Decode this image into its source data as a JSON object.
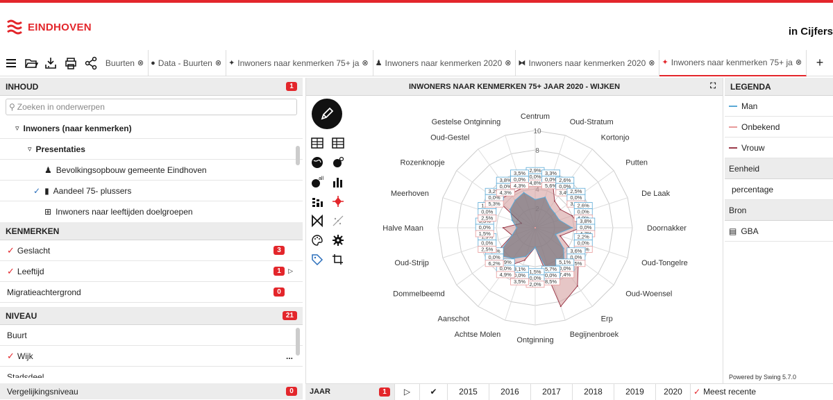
{
  "header": {
    "brand": "EINDHOVEN",
    "title": "in Cijfers"
  },
  "toolbar": {
    "tabs": [
      {
        "label": "Buurten",
        "icon": "none"
      },
      {
        "label": "Data - Buurten",
        "icon": "globe-icon"
      },
      {
        "label": "Inwoners naar kenmerken 75+ ja",
        "icon": "crosshair-icon"
      },
      {
        "label": "Inwoners naar kenmerken 2020",
        "icon": "population-icon"
      },
      {
        "label": "Inwoners naar kenmerken 2020",
        "icon": "butterfly-icon"
      },
      {
        "label": "Inwoners naar kenmerken 75+ ja",
        "icon": "crosshair-icon"
      }
    ],
    "add_label": "+"
  },
  "inhoud": {
    "title": "INHOUD",
    "count": "1",
    "search_placeholder": "Zoeken in onderwerpen",
    "items": [
      {
        "label": "Inwoners (naar kenmerken)",
        "prefix": "▿"
      },
      {
        "label": "Presentaties",
        "prefix": "▿"
      },
      {
        "label": "Bevolkingsopbouw gemeente Eindhoven",
        "prefix": ""
      },
      {
        "label": "Aandeel 75- plussers",
        "prefix": "✓"
      },
      {
        "label": "Inwoners naar leeftijden doelgroepen",
        "prefix": ""
      }
    ]
  },
  "kenmerken": {
    "title": "KENMERKEN",
    "items": [
      {
        "label": "Geslacht",
        "count": "3",
        "checked": true
      },
      {
        "label": "Leeftijd",
        "count": "1",
        "checked": true
      },
      {
        "label": "Migratieachtergrond",
        "count": "0",
        "checked": false
      }
    ]
  },
  "niveau": {
    "title": "NIVEAU",
    "count": "21",
    "items": [
      {
        "label": "Buurt",
        "checked": false
      },
      {
        "label": "Wijk",
        "checked": true,
        "more": "..."
      },
      {
        "label": "Stadsdeel",
        "checked": false
      }
    ]
  },
  "vergelijk": {
    "label": "Vergelijkingsniveau",
    "count": "0"
  },
  "chart_panel": {
    "title": "INWONERS NAAR KENMERKEN 75+ JAAR 2020 - WIJKEN"
  },
  "legenda": {
    "title": "LEGENDA",
    "series": [
      {
        "label": "Man",
        "color": "#5aa9d6"
      },
      {
        "label": "Onbekend",
        "color": "#e89a9a"
      },
      {
        "label": "Vrouw",
        "color": "#9b3a4a"
      }
    ],
    "eenheid_label": "Eenheid",
    "eenheid_value": "percentage",
    "bron_label": "Bron",
    "bron_value": "GBA",
    "powered": "Powered by Swing 5.7.0"
  },
  "jaar": {
    "title": "JAAR",
    "count": "1",
    "years": [
      "2015",
      "2016",
      "2017",
      "2018",
      "2019",
      "2020"
    ],
    "recent": "Meest recente"
  },
  "chart_data": {
    "type": "radar",
    "axes": [
      "Centrum",
      "Oud-Stratum",
      "Kortonjo",
      "Putten",
      "De Laak",
      "Doornakker",
      "Oud-Tongelre",
      "Oud-Woensel",
      "Erp",
      "Begijnenbroek",
      "Ontginning",
      "Achtse Molen",
      "Aanschot",
      "Dommelbeemd",
      "Oud-Strijp",
      "Halve Maan",
      "Meerhoven",
      "Rozenknopje",
      "Oud-Gestel",
      "Gestelse Ontginning"
    ],
    "rlim": [
      0,
      10
    ],
    "ticks": [
      "2",
      "4",
      "6",
      "8",
      "10"
    ],
    "series": [
      {
        "name": "Man",
        "values": [
          2.9,
          3.3,
          2.6,
          2.5,
          2.6,
          3.8,
          2.2,
          3.6,
          5.1,
          5.7,
          2.0,
          3.1,
          3.9,
          4.8,
          2.5,
          1.9,
          2.5,
          3.2,
          3.5,
          3.8
        ]
      },
      {
        "name": "Onbekend",
        "values": [
          0.0,
          0.0,
          0.0,
          0.0,
          0.0,
          0.0,
          0.0,
          0.0,
          0.0,
          0.0,
          0.0,
          0.0,
          0.0,
          0.0,
          0.0,
          0.0,
          0.0,
          0.0,
          0.0,
          0.0
        ]
      },
      {
        "name": "Vrouw",
        "values": [
          4.8,
          5.6,
          3.4,
          3.2,
          4.0,
          4.7,
          2.7,
          5.5,
          7.4,
          8.5,
          2.0,
          3.5,
          4.9,
          6.2,
          2.5,
          3.3,
          1.5,
          4.8,
          4.3,
          4.3
        ]
      }
    ],
    "data_labels": [
      [
        "2,9%",
        "0,0%",
        "4,8%"
      ],
      [
        "3,3%",
        "0,0%",
        "5,6%"
      ],
      [
        "2,6%",
        "0,0%",
        "3,4%"
      ],
      [
        "2,5%",
        "0,0%",
        "3,2%"
      ],
      [
        "2,6%",
        "0,0%",
        "4,0%"
      ],
      [
        "3,8%",
        "0,0%",
        "4,7%"
      ],
      [
        "2,2%",
        "0,0%",
        "2,7%"
      ],
      [
        "3,6%",
        "0,0%",
        "5,5%"
      ],
      [
        "5,1%",
        "0,0%",
        "7,4%"
      ],
      [
        "5,7%",
        "0,0%",
        "8,5%"
      ],
      [
        "1,5%",
        "0,0%",
        "2,0%"
      ],
      [
        "3,1%",
        "0,0%",
        "3,5%"
      ],
      [
        "3,9%",
        "0,0%",
        "4,9%"
      ],
      [
        "4,8%",
        "0,0%",
        "6,2%"
      ],
      [
        "1,9%",
        "0,0%",
        "2,5%"
      ],
      [
        "3,3%",
        "0,0%",
        "1,5%"
      ],
      [
        "1,5%",
        "0,0%",
        "2,5%"
      ],
      [
        "3,2%",
        "0,0%",
        "5,3%"
      ],
      [
        "3,8%",
        "0,0%",
        "4,3%"
      ],
      [
        "3,5%",
        "0,0%",
        "4,3%"
      ]
    ]
  }
}
